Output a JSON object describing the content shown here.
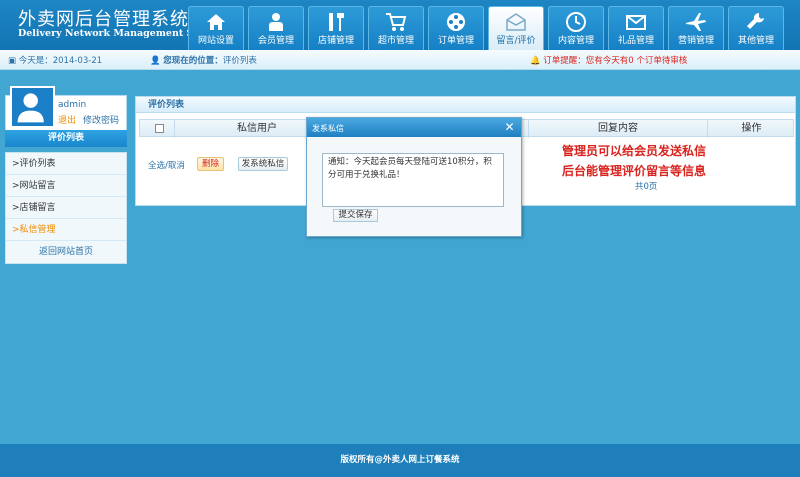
{
  "header": {
    "logo_cn": "外卖网后台管理系统",
    "logo_en": "Delivery Network Management System"
  },
  "nav": {
    "items": [
      {
        "label": "网站设置",
        "icon": "home-icon"
      },
      {
        "label": "会员管理",
        "icon": "user-icon"
      },
      {
        "label": "店铺管理",
        "icon": "tools-icon"
      },
      {
        "label": "超市管理",
        "icon": "cart-icon"
      },
      {
        "label": "订单管理",
        "icon": "film-reel-icon"
      },
      {
        "label": "留言/评价",
        "icon": "mail-open-icon"
      },
      {
        "label": "内容管理",
        "icon": "clock-icon"
      },
      {
        "label": "礼品管理",
        "icon": "envelope-icon"
      },
      {
        "label": "营销管理",
        "icon": "plane-icon"
      },
      {
        "label": "其他管理",
        "icon": "wrench-icon"
      }
    ],
    "active_index": 5
  },
  "infobar": {
    "date_text": "今天是：2014-03-21",
    "location_label": "您现在的位置：",
    "location_value": "评价列表",
    "order_alert": "订单提醒：您有今天有0 个订单待审核"
  },
  "sidebar": {
    "username": "admin",
    "logout": "退出",
    "change_password": "修改密码",
    "section_title": "评价列表",
    "items": [
      {
        "label": ">评价列表"
      },
      {
        "label": ">网站留言"
      },
      {
        "label": ">店铺留言"
      },
      {
        "label": ">私信管理"
      }
    ],
    "back_link": "返回网站首页"
  },
  "main": {
    "panel_title": "评价列表",
    "columns": [
      "私信用户",
      "回复内容",
      "操作"
    ],
    "select_all": "全选/取消",
    "delete_button": "删除",
    "send_button": "发系统私信",
    "note_line1": "管理员可以给会员发送私信",
    "note_line2": "后台能管理评价留言等信息",
    "pages": "共0页"
  },
  "dialog": {
    "title": "发系私信",
    "message": "通知：今天起会员每天登陆可送10积分，积分可用于兑换礼品！",
    "submit": "提交保存"
  },
  "footer": {
    "copyright": "版权所有@外卖人网上订餐系统"
  },
  "colors": {
    "header": "#1274b3",
    "body_bg": "#41a7d2",
    "accent_red": "#d9241f",
    "accent_orange": "#f08c00",
    "link_blue": "#2b72a8"
  }
}
